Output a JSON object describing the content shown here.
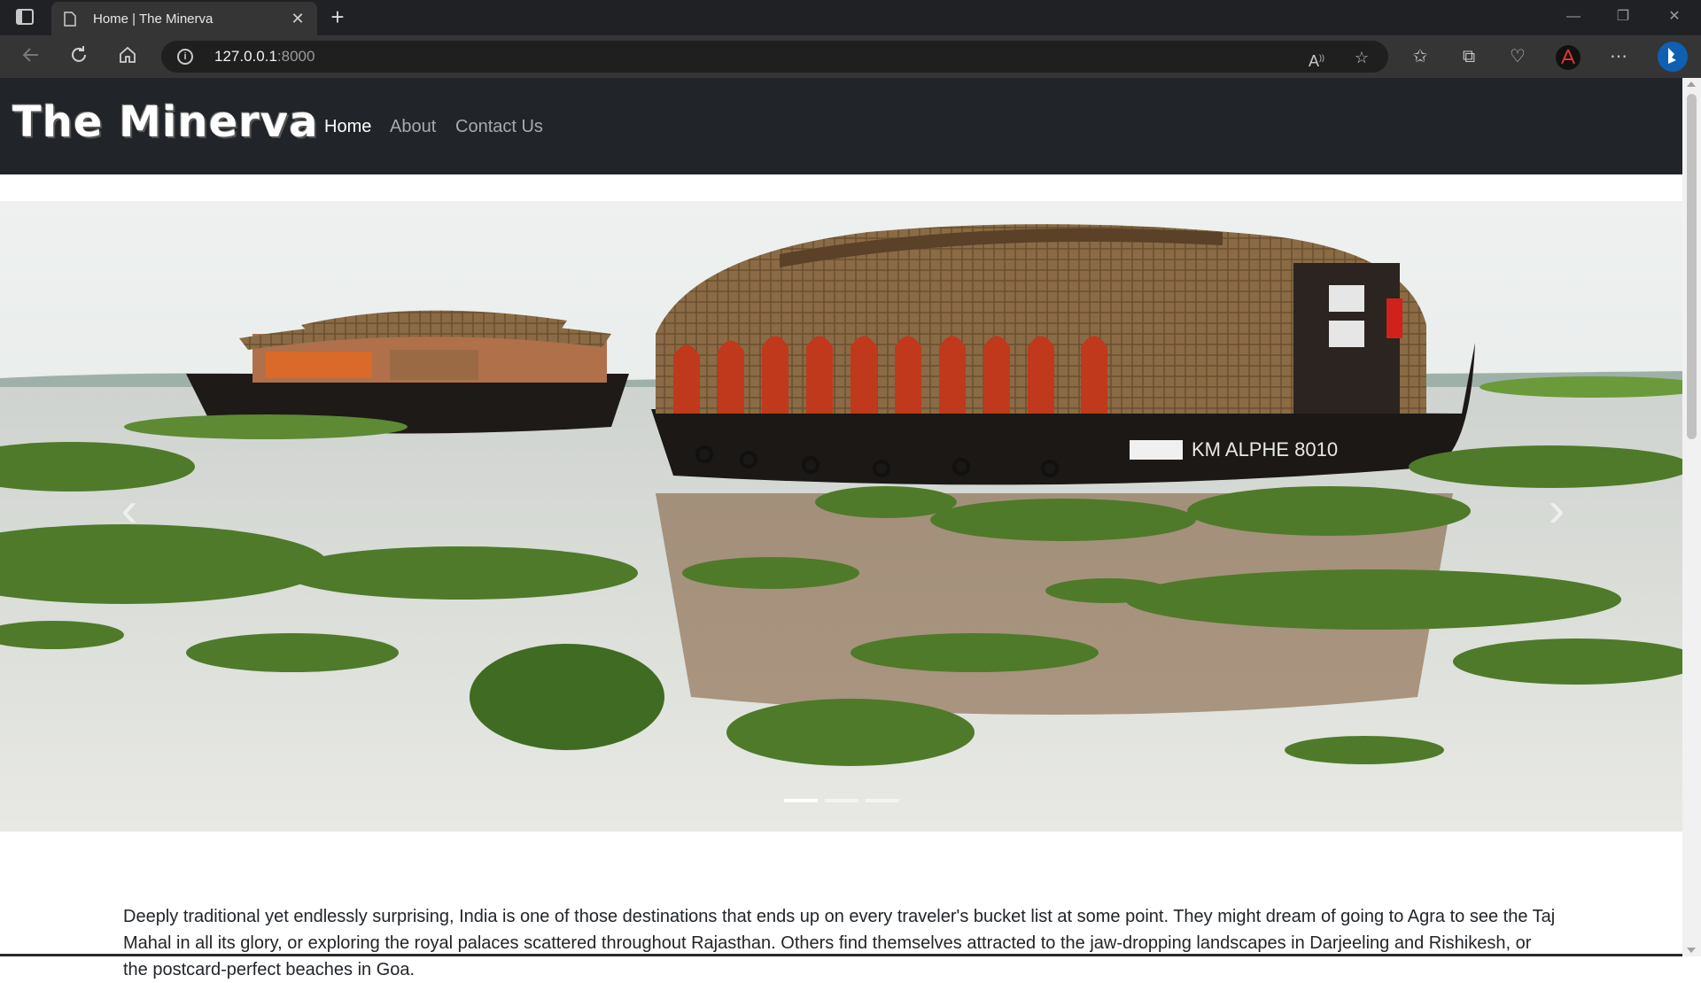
{
  "browser": {
    "tab_title": "Home | The Minerva",
    "url_host": "127.0.0.1",
    "url_port": ":8000",
    "close_tab": "✕",
    "new_tab": "+",
    "min": "—",
    "restore": "❐",
    "close_win": "✕"
  },
  "site": {
    "brand": "The Minerva",
    "nav": [
      "Home",
      "About",
      "Contact Us"
    ],
    "active_nav": "Home"
  },
  "carousel": {
    "slide_count": 3,
    "active_index": 0,
    "prev": "‹",
    "next": "›"
  },
  "content": {
    "paragraph": "Deeply traditional yet endlessly surprising, India is one of those destinations that ends up on every traveler's bucket list at some point. They might dream of going to Agra to see the Taj Mahal in all its glory, or exploring the royal palaces scattered throughout Rajasthan. Others find themselves attracted to the jaw-dropping landscapes in Darjeeling and Rishikesh, or the postcard-perfect beaches in Goa."
  },
  "colors": {
    "navbar": "#212529",
    "chrome_dark": "#202124",
    "chrome_bar": "#353535"
  },
  "icons": [
    "tabs-icon",
    "page-icon",
    "back-icon",
    "refresh-icon",
    "home-icon",
    "info-icon",
    "read-aloud-icon",
    "favorite-star-icon",
    "favorites-icon",
    "collections-icon",
    "browser-essentials-icon",
    "profile-icon",
    "more-icon",
    "bing-icon"
  ]
}
